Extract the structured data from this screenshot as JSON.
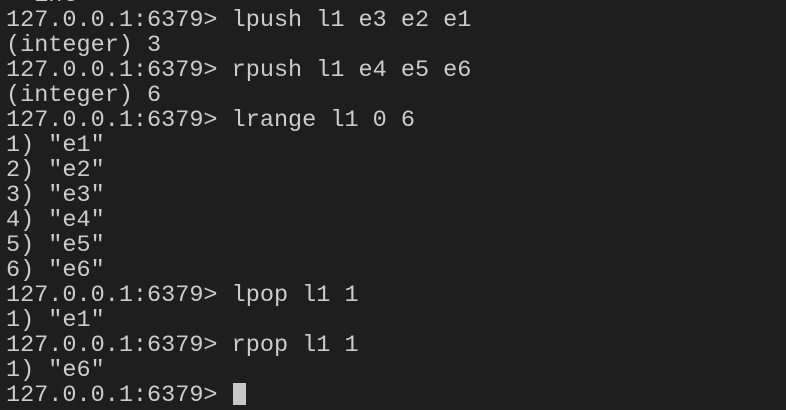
{
  "terminal": {
    "lines": [
      "  int",
      "127.0.0.1:6379> lpush l1 e3 e2 e1",
      "(integer) 3",
      "127.0.0.1:6379> rpush l1 e4 e5 e6",
      "(integer) 6",
      "127.0.0.1:6379> lrange l1 0 6",
      "1) \"e1\"",
      "2) \"e2\"",
      "3) \"e3\"",
      "4) \"e4\"",
      "5) \"e5\"",
      "6) \"e6\"",
      "127.0.0.1:6379> lpop l1 1",
      "1) \"e1\"",
      "127.0.0.1:6379> rpop l1 1",
      "1) \"e6\""
    ],
    "prompt": "127.0.0.1:6379> "
  }
}
